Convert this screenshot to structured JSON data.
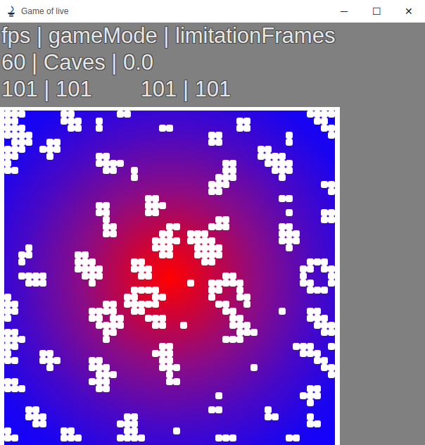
{
  "window": {
    "title": "Game of live",
    "controls": [
      "─",
      "☐",
      "✕"
    ]
  },
  "hud": {
    "lines": [
      "fps | gameMode | limitationFrames",
      "60 | Caves | 0.0",
      "101 | 101        101 | 101"
    ]
  },
  "board": {
    "alive": [
      [
        0,
        1,
        2,
        8,
        9,
        16,
        17,
        43,
        44,
        45,
        46
      ],
      [
        0,
        1,
        8,
        9,
        10,
        13,
        33,
        34,
        44,
        45
      ],
      [
        0,
        1,
        2,
        9,
        10,
        13,
        22,
        23,
        33,
        34,
        45,
        46
      ],
      [
        0,
        1,
        2,
        3,
        29,
        30,
        40,
        46
      ],
      [
        1,
        2,
        3,
        6,
        7,
        29,
        30,
        40
      ],
      [
        0,
        1,
        2,
        5,
        6,
        7,
        36,
        37
      ],
      [
        0,
        1,
        6,
        13,
        14,
        36,
        37,
        38,
        39
      ],
      [
        0,
        13,
        14,
        15,
        16,
        31,
        32,
        37,
        38,
        39,
        40
      ],
      [
        0,
        1,
        14,
        15,
        18,
        31,
        32,
        38,
        39,
        40
      ],
      [
        18,
        30,
        31,
        32,
        39
      ],
      [
        29,
        30,
        31,
        45,
        46
      ],
      [
        29,
        30,
        46
      ],
      [
        20,
        21,
        39,
        40
      ],
      [
        13,
        14,
        20,
        21,
        22
      ],
      [
        13,
        14,
        20,
        21,
        40,
        45,
        46
      ],
      [
        14,
        30,
        31,
        45,
        46
      ],
      [
        14,
        15,
        23,
        24,
        29,
        30,
        31,
        39,
        40
      ],
      [
        14,
        15,
        22,
        23,
        26,
        27,
        28,
        39,
        40,
        41
      ],
      [
        21,
        22,
        23,
        24,
        26,
        27,
        28,
        29,
        39,
        40,
        41
      ],
      [
        3,
        21,
        22,
        23,
        27,
        28,
        29,
        30,
        40
      ],
      [
        2,
        3,
        10,
        11,
        22,
        23,
        27,
        28,
        29,
        30
      ],
      [
        2,
        10,
        11,
        12,
        18,
        19,
        28,
        29,
        43,
        44,
        45
      ],
      [
        10,
        11,
        12,
        13,
        18,
        19,
        20,
        42,
        43,
        45,
        46
      ],
      [
        2,
        3,
        4,
        5,
        11,
        12,
        13,
        19,
        20,
        31,
        32,
        42,
        46
      ],
      [
        3,
        4,
        5,
        12,
        26,
        29,
        30,
        31,
        32,
        33,
        42,
        43,
        46
      ],
      [
        18,
        19,
        20,
        21,
        29,
        30,
        33,
        43,
        44,
        45
      ],
      [
        0,
        17,
        18,
        21,
        22,
        29,
        33,
        34
      ],
      [
        0,
        1,
        14,
        15,
        17,
        18,
        19,
        20,
        21,
        30,
        31,
        34
      ],
      [
        0,
        1,
        12,
        13,
        14,
        15,
        18,
        19,
        31,
        32,
        39,
        43,
        44
      ],
      [
        0,
        12,
        13,
        15,
        16,
        20,
        21,
        22,
        32,
        33,
        43,
        44,
        45
      ],
      [
        13,
        14,
        15,
        16,
        21,
        22,
        25,
        32,
        33,
        34,
        44,
        45,
        46
      ],
      [
        0,
        1,
        14,
        15,
        33,
        34,
        35,
        45,
        46
      ],
      [
        0,
        1,
        2,
        14,
        31,
        32,
        33
      ],
      [
        0,
        1,
        22,
        23,
        41,
        42,
        43,
        46
      ],
      [
        0,
        5,
        6,
        21,
        22,
        23,
        42,
        43,
        44
      ],
      [
        0,
        1,
        5,
        6,
        7,
        12,
        13,
        22,
        23,
        44,
        45
      ],
      [
        6,
        12,
        13,
        14,
        22,
        23,
        24,
        35,
        45,
        46
      ],
      [
        13,
        14,
        15,
        23,
        46
      ],
      [
        0,
        1,
        12,
        13,
        14,
        23,
        24
      ],
      [
        0,
        1,
        2,
        13,
        14,
        43,
        44
      ],
      [
        30,
        42,
        43,
        44
      ],
      [
        43
      ],
      [
        3,
        4,
        29,
        30,
        37
      ],
      [
        3,
        4,
        5,
        17,
        18,
        37,
        38,
        43
      ],
      [
        4,
        5,
        16,
        17,
        18,
        43,
        44
      ],
      [
        0,
        8,
        9,
        17,
        18,
        24
      ],
      [
        0,
        1,
        8,
        9,
        10,
        16,
        17,
        18,
        19,
        30,
        31,
        32,
        40,
        41
      ]
    ]
  }
}
